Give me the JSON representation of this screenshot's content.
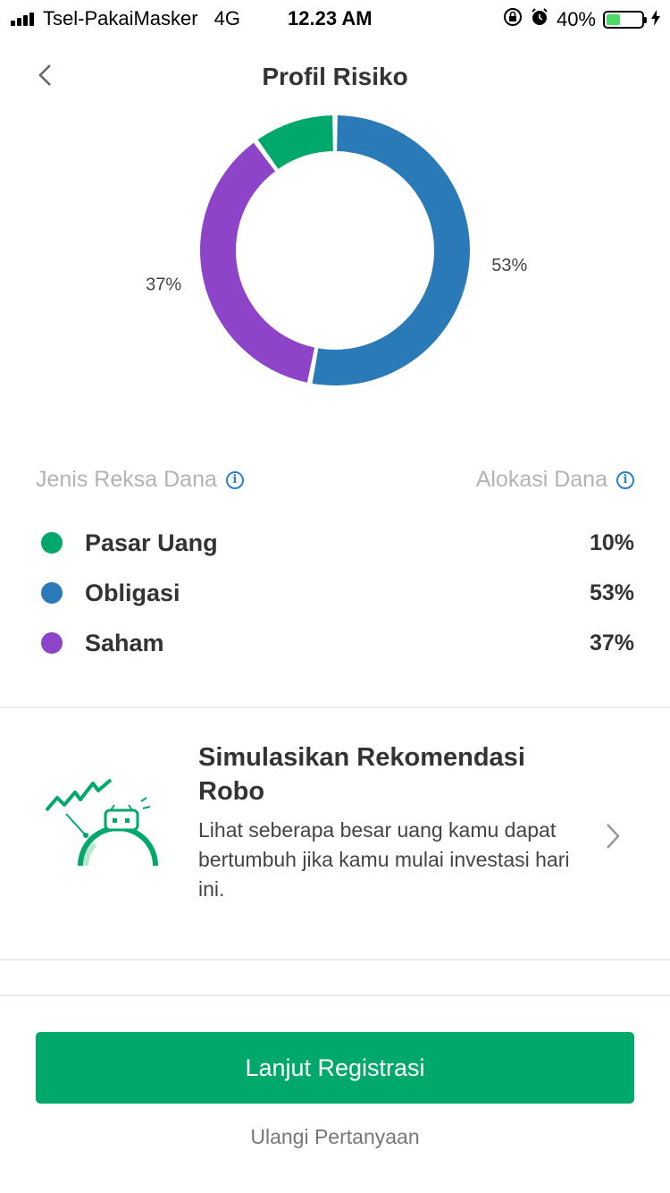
{
  "status_bar": {
    "carrier": "Tsel-PakaiMasker",
    "network": "4G",
    "time": "12.23 AM",
    "battery": "40%",
    "battery_level": 0.4,
    "icons": [
      "signal-icon",
      "orientation-lock-icon",
      "alarm-icon",
      "battery-icon",
      "charging-icon"
    ]
  },
  "header": {
    "title": "Profil Risiko",
    "back_icon": "chevron-left-icon"
  },
  "chart_data": {
    "type": "pie",
    "categories": [
      "Pasar Uang",
      "Obligasi",
      "Saham"
    ],
    "values": [
      10,
      53,
      37
    ],
    "colors": [
      "#00a86b",
      "#2a7ab8",
      "#8e44c9"
    ],
    "data_labels": [
      "",
      "53%",
      "37%"
    ]
  },
  "legend": {
    "head_left": "Jenis Reksa Dana",
    "head_right": "Alokasi Dana",
    "info_icon": "info-icon",
    "items": [
      {
        "label": "Pasar Uang",
        "value": "10%",
        "color": "#00a86b"
      },
      {
        "label": "Obligasi",
        "value": "53%",
        "color": "#2a7ab8"
      },
      {
        "label": "Saham",
        "value": "37%",
        "color": "#8e44c9"
      }
    ]
  },
  "simulation_card": {
    "title": "Simulasikan Rekomendasi Robo",
    "description": "Lihat seberapa besar uang kamu dapat bertumbuh jika kamu mulai investasi hari ini.",
    "illustration": "robo-growth-illustration",
    "chevron_icon": "chevron-right-icon"
  },
  "actions": {
    "primary": "Lanjut Registrasi",
    "secondary": "Ulangi Pertanyaan"
  },
  "colors": {
    "accent": "#00a86b",
    "info": "#2a7fd4"
  }
}
